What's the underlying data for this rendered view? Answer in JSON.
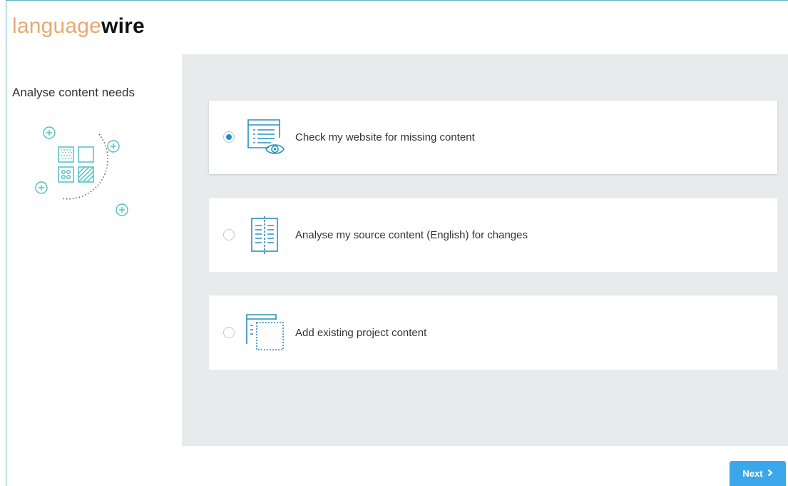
{
  "brand": {
    "logo_light": "language",
    "logo_bold": "wire"
  },
  "sidebar": {
    "title": "Analyse content needs"
  },
  "options": [
    {
      "label": "Check my website for missing content",
      "selected": true,
      "icon": "website-eye-icon"
    },
    {
      "label": "Analyse my source content (English) for changes",
      "selected": false,
      "icon": "book-document-icon"
    },
    {
      "label": "Add existing project content",
      "selected": false,
      "icon": "add-project-content-icon"
    }
  ],
  "footer": {
    "next_label": "Next",
    "next_icon": "chevron-right-icon"
  },
  "colors": {
    "accent": "#1d8fd3",
    "button": "#3aa7ea",
    "icon_blue": "#2a8fbf",
    "illustration": "#4fc0c9",
    "logo_orange": "#e8a872",
    "panel_bg": "#e8ebec",
    "frame": "#5fb5c4"
  }
}
